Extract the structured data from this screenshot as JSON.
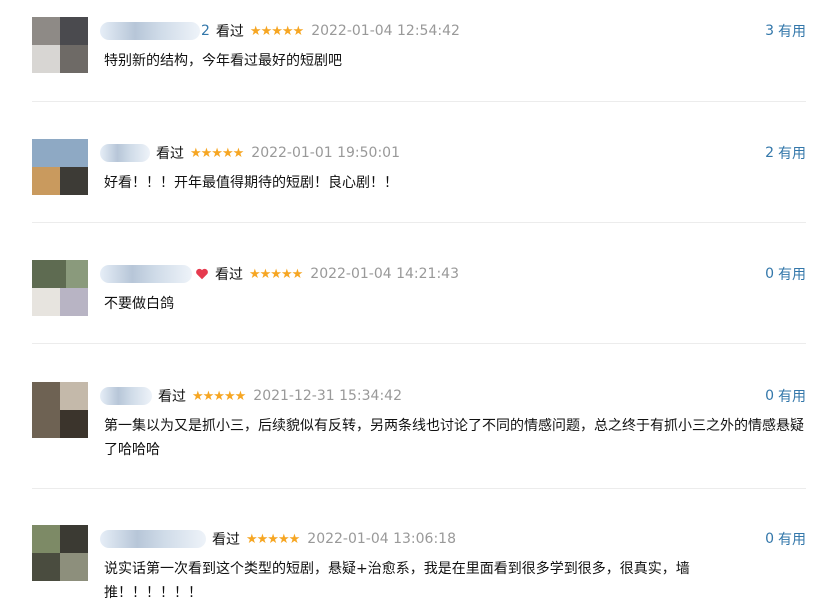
{
  "comments": [
    {
      "user_suffix": "2",
      "status": "看过",
      "stars": "★★★★★",
      "time": "2022-01-04 12:54:42",
      "useful_count": "3",
      "useful_label": "有用",
      "text": "特别新的结构，今年看过最好的短剧吧"
    },
    {
      "user_suffix": "",
      "status": "看过",
      "stars": "★★★★★",
      "time": "2022-01-01 19:50:01",
      "useful_count": "2",
      "useful_label": "有用",
      "text": "好看！！！开年最值得期待的短剧！良心剧！！"
    },
    {
      "user_suffix": "",
      "status": "看过",
      "stars": "★★★★★",
      "time": "2022-01-04 14:21:43",
      "useful_count": "0",
      "useful_label": "有用",
      "text": "不要做白鸽"
    },
    {
      "user_suffix": "",
      "status": "看过",
      "stars": "★★★★★",
      "time": "2021-12-31 15:34:42",
      "useful_count": "0",
      "useful_label": "有用",
      "text": "第一集以为又是抓小三，后续貌似有反转，另两条线也讨论了不同的情感问题，总之终于有抓小三之外的情感悬疑了哈哈哈"
    },
    {
      "user_suffix": "",
      "status": "看过",
      "stars": "★★★★★",
      "time": "2022-01-04 13:06:18",
      "useful_count": "0",
      "useful_label": "有用",
      "text": "说实话第一次看到这个类型的短剧，悬疑+治愈系，我是在里面看到很多学到很多，很真实，墙推！！！！！！"
    }
  ],
  "colors": {
    "link": "#3377aa",
    "star": "#f6a623",
    "time": "#999999"
  }
}
